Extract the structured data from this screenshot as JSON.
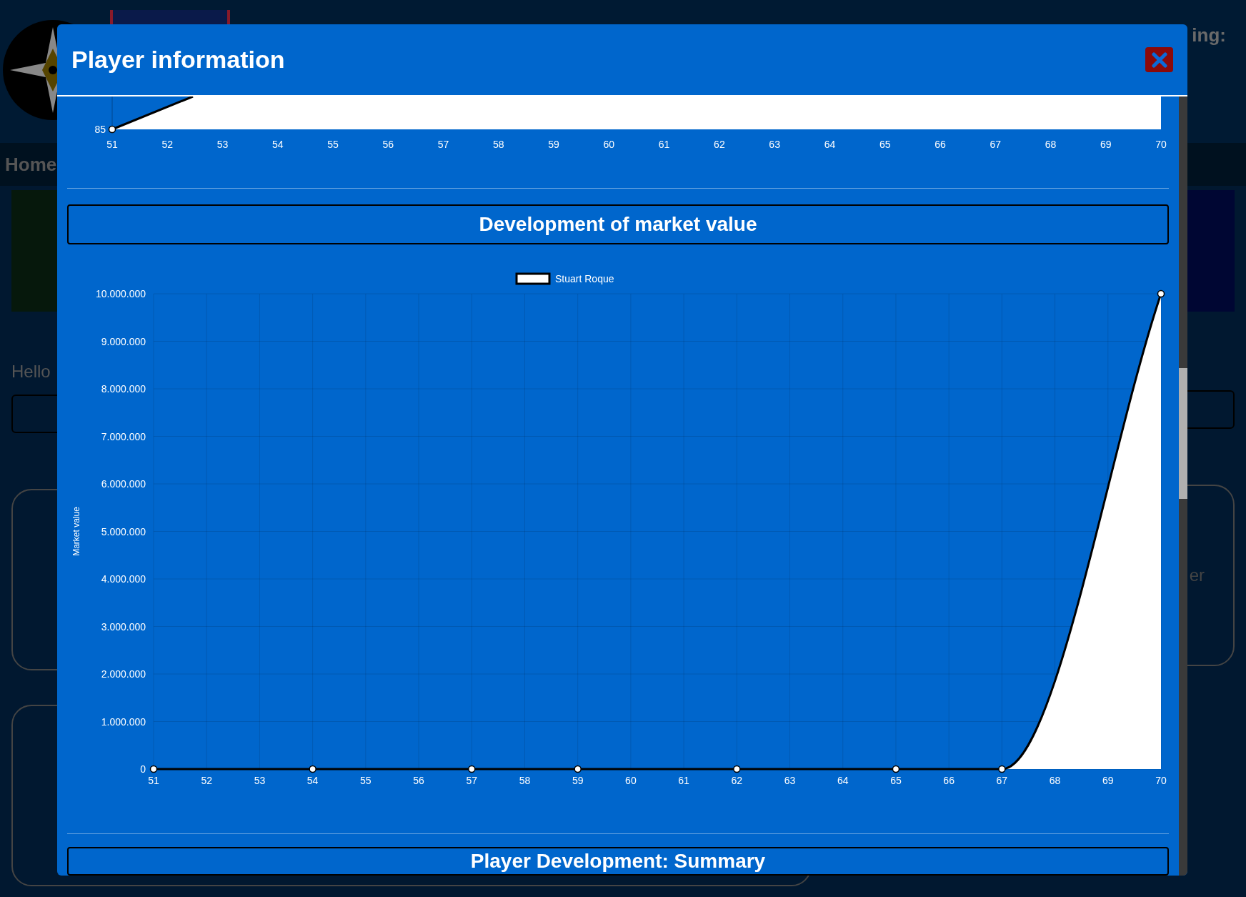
{
  "background": {
    "header_fragment": "ing:",
    "nav_label": "Home",
    "greeting": "Hello",
    "card_fragment": "er"
  },
  "modal": {
    "title": "Player information",
    "top_chart": {
      "y_tick": "85",
      "x_labels": [
        "51",
        "52",
        "53",
        "54",
        "55",
        "56",
        "57",
        "58",
        "59",
        "60",
        "61",
        "62",
        "63",
        "64",
        "65",
        "66",
        "67",
        "68",
        "69",
        "70"
      ]
    },
    "sections": [
      {
        "title": "Development of market value",
        "chart_data": {
          "type": "area",
          "ylabel": "Market value",
          "x": [
            51,
            52,
            53,
            54,
            55,
            56,
            57,
            58,
            59,
            60,
            61,
            62,
            63,
            64,
            65,
            66,
            67,
            68,
            69,
            70
          ],
          "series": [
            {
              "name": "Stuart Roque",
              "color": "#ffffff",
              "values": [
                0,
                null,
                null,
                0,
                null,
                null,
                0,
                null,
                0,
                null,
                null,
                0,
                null,
                null,
                0,
                null,
                0,
                null,
                null,
                10000000
              ]
            }
          ],
          "ylim": [
            0,
            10000000
          ],
          "xlim": [
            51,
            70
          ],
          "grid": true,
          "yticks": [
            {
              "value": 0,
              "label": "0"
            },
            {
              "value": 1000000,
              "label": "1.000.000"
            },
            {
              "value": 2000000,
              "label": "2.000.000"
            },
            {
              "value": 3000000,
              "label": "3.000.000"
            },
            {
              "value": 4000000,
              "label": "4.000.000"
            },
            {
              "value": 5000000,
              "label": "5.000.000"
            },
            {
              "value": 6000000,
              "label": "6.000.000"
            },
            {
              "value": 7000000,
              "label": "7.000.000"
            },
            {
              "value": 8000000,
              "label": "8.000.000"
            },
            {
              "value": 9000000,
              "label": "9.000.000"
            },
            {
              "value": 10000000,
              "label": "10.000.000"
            }
          ],
          "xticks": [
            51,
            52,
            53,
            54,
            55,
            56,
            57,
            58,
            59,
            60,
            61,
            62,
            63,
            64,
            65,
            66,
            67,
            68,
            69,
            70
          ]
        }
      },
      {
        "title": "Player Development: Summary"
      }
    ]
  }
}
